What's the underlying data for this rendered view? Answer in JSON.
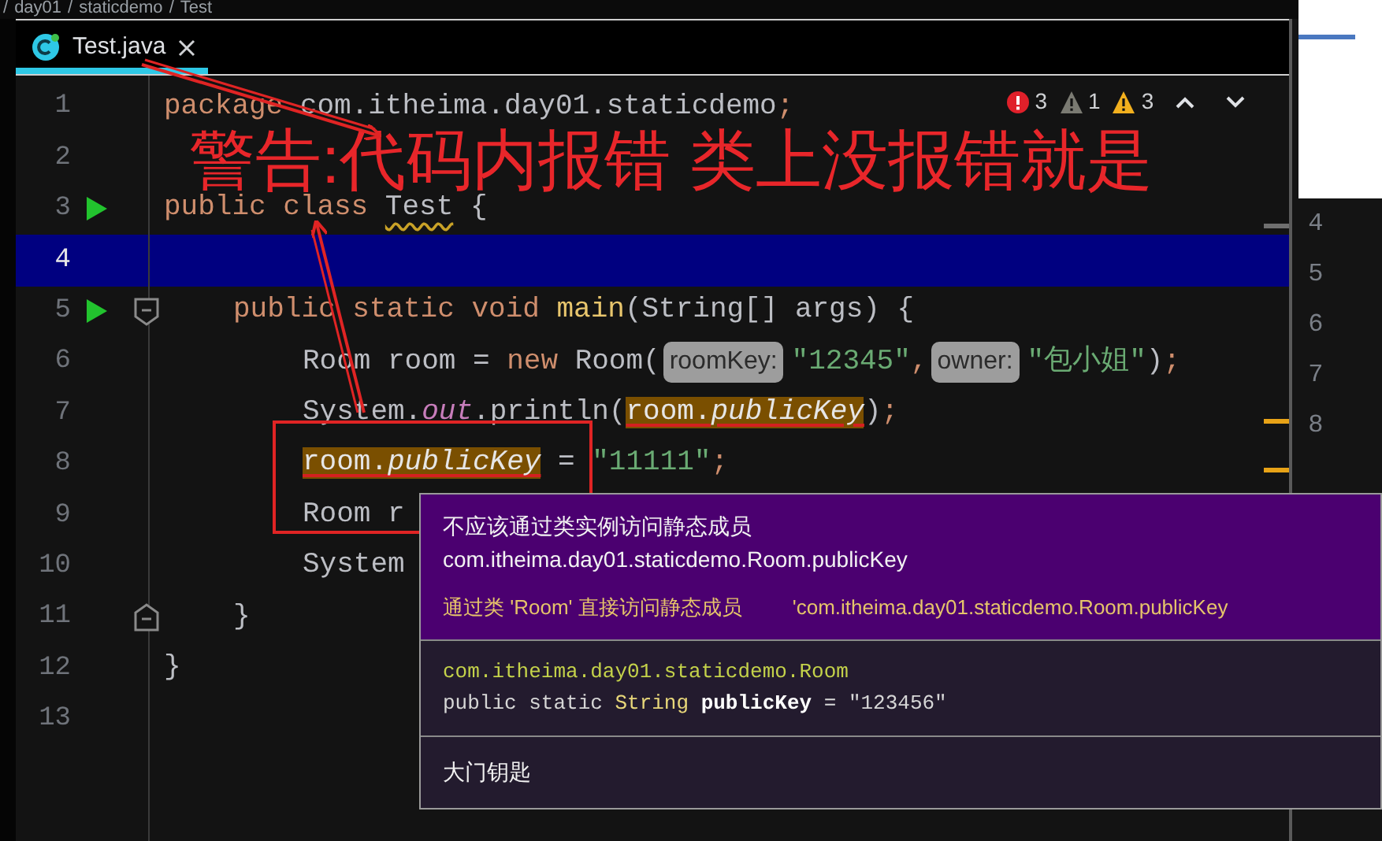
{
  "breadcrumb": {
    "separator": "/",
    "items": [
      "day01",
      "staticdemo",
      "Test"
    ]
  },
  "tabs": [
    {
      "label": "Test.java",
      "selected": true
    }
  ],
  "inspections": {
    "errors": "3",
    "weak_warnings": "1",
    "warnings": "3"
  },
  "lines": [
    {
      "number": "1",
      "current": false,
      "runnable": false,
      "tokens": [
        {
          "kind": "keyword",
          "text": "package"
        },
        {
          "kind": "plain",
          "text": " com.itheima.day01.staticdemo"
        },
        {
          "kind": "punct",
          "text": ";"
        }
      ]
    },
    {
      "number": "2",
      "current": false,
      "runnable": false
    },
    {
      "number": "3",
      "current": false,
      "runnable": true,
      "tokens": [
        {
          "kind": "keyword",
          "text": "public class "
        },
        {
          "kind": "warned",
          "text": "Test"
        },
        {
          "kind": "plain",
          "text": " {"
        }
      ],
      "children": [
        {
          "number": "4",
          "current": true,
          "runnable": false
        },
        {
          "number": "5",
          "kind": "fold-start",
          "current": false,
          "runnable": true,
          "tokens": [
            {
              "kind": "keyword",
              "text": "public static void "
            },
            {
              "kind": "method",
              "text": "main"
            },
            {
              "kind": "plain",
              "text": "(String[] args) {"
            }
          ],
          "children": [
            {
              "number": "6",
              "current": false,
              "runnable": false,
              "tokens": [
                {
                  "kind": "plain",
                  "text": "Room room = "
                },
                {
                  "kind": "keyword",
                  "text": "new"
                },
                {
                  "kind": "plain",
                  "text": " Room("
                },
                {
                  "kind": "hint",
                  "text": "roomKey:"
                },
                {
                  "kind": "string",
                  "text": "\"12345\""
                },
                {
                  "kind": "punct",
                  "text": ","
                },
                {
                  "kind": "hint",
                  "text": "owner:"
                },
                {
                  "kind": "string",
                  "text": "\"包小姐\""
                },
                {
                  "kind": "plain",
                  "text": ")"
                },
                {
                  "kind": "punct",
                  "text": ";"
                }
              ]
            },
            {
              "number": "7",
              "current": false,
              "runnable": false,
              "tokens": [
                {
                  "kind": "plain",
                  "text": "System."
                },
                {
                  "kind": "static",
                  "text": "out"
                },
                {
                  "kind": "plain",
                  "text": ".println("
                },
                {
                  "kind": "flagged",
                  "text": "room."
                },
                {
                  "kind": "flagged-italic",
                  "text": "publicKey"
                },
                {
                  "kind": "plain",
                  "text": ")"
                },
                {
                  "kind": "punct",
                  "text": ";"
                }
              ]
            },
            {
              "number": "8",
              "current": false,
              "runnable": false,
              "tokens": [
                {
                  "kind": "flagged",
                  "text": "room."
                },
                {
                  "kind": "flagged-italic",
                  "text": "publicKey"
                },
                {
                  "kind": "plain",
                  "text": " = "
                },
                {
                  "kind": "string",
                  "text": "\"11111\""
                },
                {
                  "kind": "punct",
                  "text": ";"
                }
              ]
            },
            {
              "number": "9",
              "current": false,
              "runnable": false,
              "tokens": [
                {
                  "kind": "plain",
                  "text": "Room r"
                }
              ]
            },
            {
              "number": "10",
              "current": false,
              "runnable": false,
              "tokens": [
                {
                  "kind": "plain",
                  "text": "System"
                }
              ]
            }
          ]
        },
        {
          "number": "11",
          "kind": "fold-end",
          "current": false,
          "runnable": false,
          "tokens": [
            {
              "kind": "plain",
              "text": "}"
            }
          ]
        }
      ]
    },
    {
      "number": "12",
      "current": false,
      "runnable": false,
      "tokens": [
        {
          "kind": "plain",
          "text": "}"
        }
      ]
    },
    {
      "number": "13",
      "current": false,
      "runnable": false
    }
  ],
  "side_line_numbers": [
    "4",
    "5",
    "6",
    "7",
    "8"
  ],
  "annotation": {
    "text": "警告:代码内报错 类上没报错就是"
  },
  "tooltip": {
    "problem": "不应该通过类实例访问静态成员",
    "problem_detail": "com.itheima.day01.staticdemo.Room.publicKey",
    "fix": "通过类 'Room' 直接访问静态成员",
    "fix_detail": "'com.itheima.day01.staticdemo.Room.publicKey",
    "doc_owner": "com.itheima.day01.staticdemo.Room",
    "doc_signature": [
      {
        "kind": "plain",
        "text": "public static "
      },
      {
        "kind": "type",
        "text": "String"
      },
      {
        "kind": "bold",
        "text": " publicKey"
      },
      {
        "kind": "plain",
        "text": " = \"123456\""
      }
    ],
    "doc_text": "大门钥匙"
  }
}
